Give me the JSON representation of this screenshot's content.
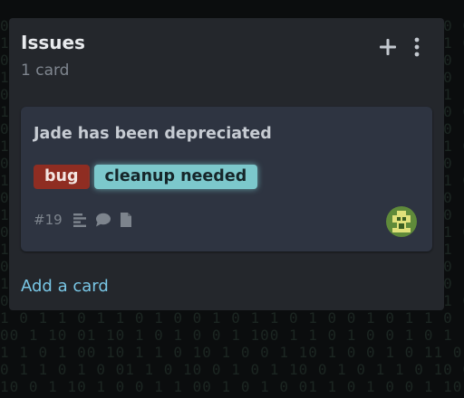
{
  "column": {
    "title": "Issues",
    "count_label": "1 card",
    "add_icon": "plus-icon",
    "menu_icon": "more-vertical-icon"
  },
  "card": {
    "title": "Jade has been depreciated",
    "labels": [
      {
        "text": "bug",
        "color": "#8f2d22"
      },
      {
        "text": "cleanup needed",
        "color": "#7cc8cc"
      }
    ],
    "issue_number": "#19",
    "icons": [
      "description-icon",
      "comment-icon",
      "attachment-icon"
    ]
  },
  "footer": {
    "add_card_label": "Add a card"
  },
  "colors": {
    "background": "#0b0d0e",
    "column": "#24272c",
    "card": "#2e3441",
    "link": "#79c7e6"
  }
}
